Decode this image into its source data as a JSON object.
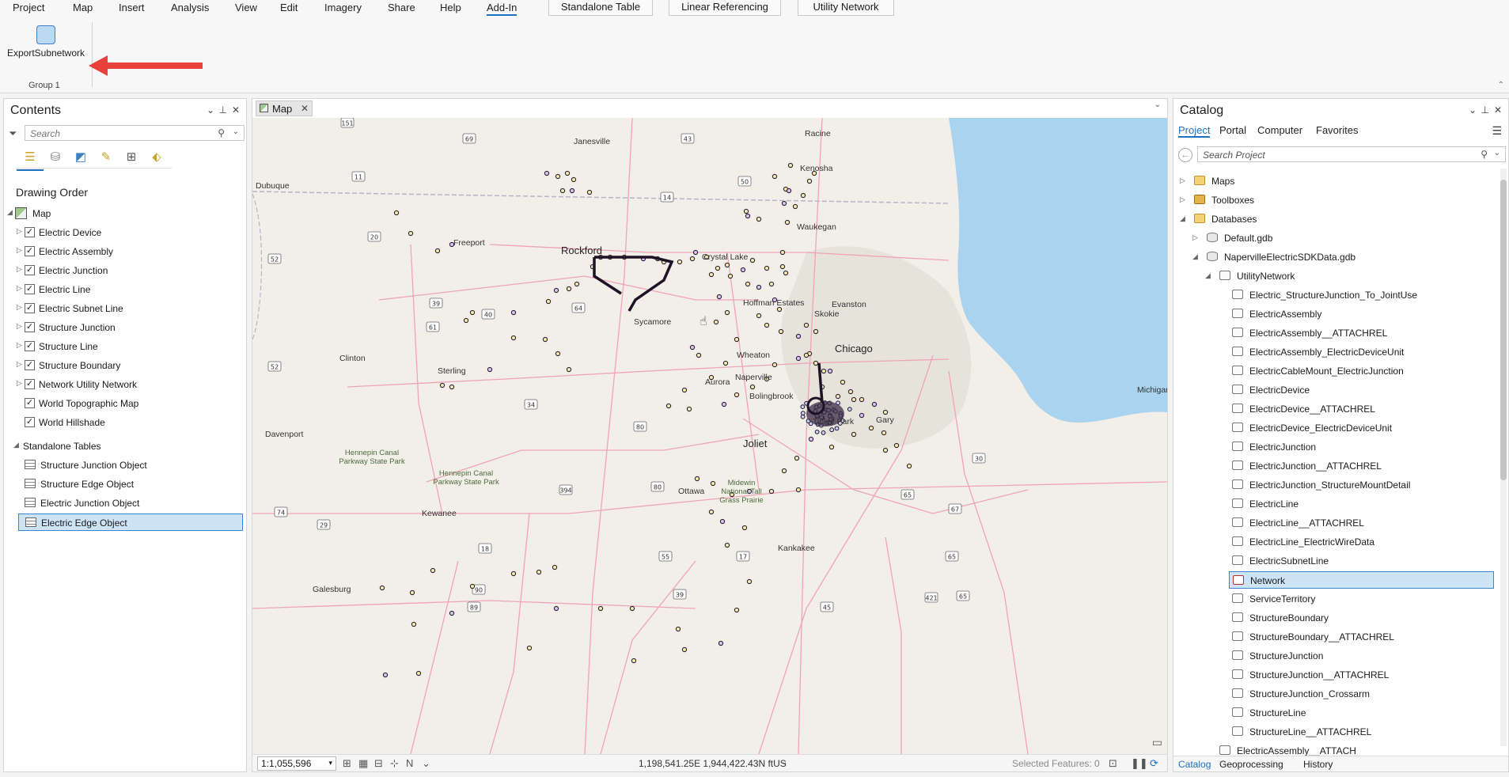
{
  "ribbon": {
    "tabs": [
      "Project",
      "Map",
      "Insert",
      "Analysis",
      "View",
      "Edit",
      "Imagery",
      "Share",
      "Help",
      "Add-In"
    ],
    "active_tab": "Add-In",
    "context_tabs": [
      "Standalone Table",
      "Linear Referencing",
      "Utility Network"
    ],
    "export_button_label": "ExportSubnetwork",
    "group_label": "Group 1",
    "annotation_arrow_color": "#e8403a"
  },
  "contents": {
    "title": "Contents",
    "search_placeholder": "Search",
    "drawing_order_label": "Drawing Order",
    "map_label": "Map",
    "layers": [
      {
        "label": "Electric Device",
        "checked": true
      },
      {
        "label": "Electric Assembly",
        "checked": true
      },
      {
        "label": "Electric Junction",
        "checked": true
      },
      {
        "label": "Electric Line",
        "checked": true
      },
      {
        "label": "Electric Subnet Line",
        "checked": true
      },
      {
        "label": "Structure Junction",
        "checked": true
      },
      {
        "label": "Structure Line",
        "checked": true
      },
      {
        "label": "Structure Boundary",
        "checked": true
      },
      {
        "label": "Network Utility Network",
        "checked": true
      },
      {
        "label": "World Topographic Map",
        "checked": true
      },
      {
        "label": "World Hillshade",
        "checked": true
      }
    ],
    "standalone_tables_label": "Standalone Tables",
    "tables": [
      "Structure Junction Object",
      "Structure Edge Object",
      "Electric Junction Object",
      "Electric Edge Object"
    ],
    "selected_table": "Electric Edge Object"
  },
  "map": {
    "tab_label": "Map",
    "scale": "1:1,055,596",
    "coordinates": "1,198,541.25E 1,944,422.43N ftUS",
    "selected_features": "Selected Features: 0",
    "places": {
      "janesville": "Janesville",
      "racine": "Racine",
      "kenosha": "Kenosha",
      "dubuque": "Dubuque",
      "waukegan": "Waukegan",
      "freeport": "Freeport",
      "rockford": "Rockford",
      "crystal_lake": "Crystal Lake",
      "hoffman_estates": "Hoffman Estates",
      "evanston": "Evanston",
      "skokie": "Skokie",
      "sycamore": "Sycamore",
      "chicago": "Chicago",
      "clinton": "Clinton",
      "wheaton": "Wheaton",
      "sterling": "Sterling",
      "aurora": "Aurora",
      "naperville": "Naperville",
      "michigan": "Michigan",
      "bolingbrook": "Bolingbrook",
      "tinley_park": "Tinley Park",
      "gary": "Gary",
      "davenport": "Davenport",
      "joliet": "Joliet",
      "hennepin1": "Hennepin Canal Parkway State Park",
      "hennepin2": "Hennepin Canal Parkway State Park",
      "midewin": "Midewin National Tall Grass Prairie",
      "ottawa": "Ottawa",
      "kewanee": "Kewanee",
      "kankakee": "Kankakee",
      "galesburg": "Galesburg"
    },
    "shields": [
      "151",
      "69",
      "43",
      "11",
      "14",
      "50",
      "20",
      "52",
      "39",
      "64",
      "40",
      "61",
      "52",
      "34",
      "80",
      "80",
      "30",
      "394",
      "65",
      "67",
      "74",
      "29",
      "18",
      "55",
      "17",
      "90",
      "39",
      "89",
      "45",
      "65",
      "421",
      "65"
    ],
    "colors": {
      "land": "#f2efe9",
      "water": "#aad3f0",
      "roads": "#f2a2b8",
      "urban": "#dedbd3",
      "point_fill": "#f6e9a8",
      "point_stroke": "#2a1f33",
      "subnet": "#1d1226"
    }
  },
  "catalog": {
    "title": "Catalog",
    "tabs": [
      "Project",
      "Portal",
      "Computer",
      "Favorites"
    ],
    "active_tab": "Project",
    "search_placeholder": "Search Project",
    "tree": [
      {
        "label": "Maps",
        "icon": "folder-icon",
        "level": 0,
        "expander": "right"
      },
      {
        "label": "Toolboxes",
        "icon": "toolbox-icon",
        "level": 0,
        "expander": "right"
      },
      {
        "label": "Databases",
        "icon": "folder-icon",
        "level": 0,
        "expander": "down"
      },
      {
        "label": "Default.gdb",
        "icon": "database-icon",
        "level": 1,
        "expander": "right"
      },
      {
        "label": "NapervilleElectricSDKData.gdb",
        "icon": "database-icon",
        "level": 1,
        "expander": "down"
      },
      {
        "label": "UtilityNetwork",
        "icon": "dataset-icon",
        "level": 2,
        "expander": "down"
      },
      {
        "label": "Electric_StructureJunction_To_JointUse",
        "icon": "relationship-icon",
        "level": 3
      },
      {
        "label": "ElectricAssembly",
        "icon": "point-class-icon",
        "level": 3
      },
      {
        "label": "ElectricAssembly__ATTACHREL",
        "icon": "relationship-icon",
        "level": 3
      },
      {
        "label": "ElectricAssembly_ElectricDeviceUnit",
        "icon": "relationship-icon",
        "level": 3
      },
      {
        "label": "ElectricCableMount_ElectricJunction",
        "icon": "relationship-icon",
        "level": 3
      },
      {
        "label": "ElectricDevice",
        "icon": "point-class-icon",
        "level": 3
      },
      {
        "label": "ElectricDevice__ATTACHREL",
        "icon": "relationship-icon",
        "level": 3
      },
      {
        "label": "ElectricDevice_ElectricDeviceUnit",
        "icon": "relationship-icon",
        "level": 3
      },
      {
        "label": "ElectricJunction",
        "icon": "point-class-icon",
        "level": 3
      },
      {
        "label": "ElectricJunction__ATTACHREL",
        "icon": "relationship-icon",
        "level": 3
      },
      {
        "label": "ElectricJunction_StructureMountDetail",
        "icon": "relationship-icon",
        "level": 3
      },
      {
        "label": "ElectricLine",
        "icon": "line-class-icon",
        "level": 3
      },
      {
        "label": "ElectricLine__ATTACHREL",
        "icon": "relationship-icon",
        "level": 3
      },
      {
        "label": "ElectricLine_ElectricWireData",
        "icon": "relationship-icon",
        "level": 3
      },
      {
        "label": "ElectricSubnetLine",
        "icon": "line-class-icon",
        "level": 3
      },
      {
        "label": "Network",
        "icon": "utility-network-icon",
        "level": 3,
        "selected": true
      },
      {
        "label": "ServiceTerritory",
        "icon": "polygon-class-icon",
        "level": 3
      },
      {
        "label": "StructureBoundary",
        "icon": "polygon-class-icon",
        "level": 3
      },
      {
        "label": "StructureBoundary__ATTACHREL",
        "icon": "relationship-icon",
        "level": 3
      },
      {
        "label": "StructureJunction",
        "icon": "point-class-icon",
        "level": 3
      },
      {
        "label": "StructureJunction__ATTACHREL",
        "icon": "relationship-icon",
        "level": 3
      },
      {
        "label": "StructureJunction_Crossarm",
        "icon": "relationship-icon",
        "level": 3
      },
      {
        "label": "StructureLine",
        "icon": "line-class-icon",
        "level": 3
      },
      {
        "label": "StructureLine__ATTACHREL",
        "icon": "relationship-icon",
        "level": 3
      },
      {
        "label": "ElectricAssembly__ATTACH",
        "icon": "table-icon",
        "level": 2
      }
    ],
    "bottom_tabs": [
      "Catalog",
      "Geoprocessing",
      "History"
    ],
    "active_bottom_tab": "Catalog"
  }
}
